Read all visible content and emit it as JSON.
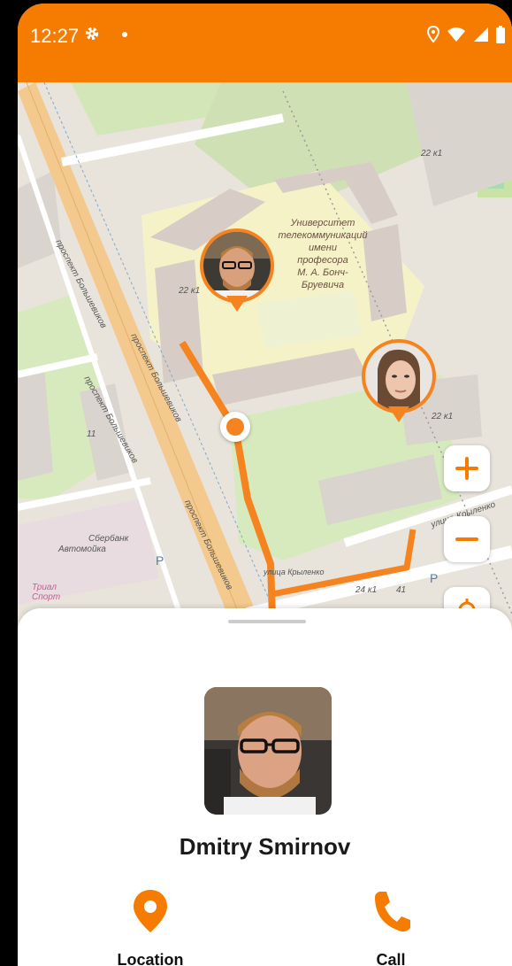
{
  "status_bar": {
    "time": "12:27"
  },
  "map": {
    "university_label_lines": [
      "Университет",
      "телекоммуникаций",
      "имени",
      "професора",
      "М. А. Бонч-",
      "Бруевича"
    ],
    "street_labels": [
      "проспект Большевиков",
      "проспект Большевиков",
      "проспект Большевиков",
      "проспект Большевиков",
      "улица Крыленко",
      "улица Крыленко"
    ],
    "building_numbers": [
      "22 к1",
      "22 к1",
      "22 к1",
      "11",
      "24 к1",
      "41"
    ],
    "poi_labels": [
      "Сбербанк",
      "Автомойка",
      "Триал Спорт"
    ],
    "parking_label": "P"
  },
  "profile": {
    "name": "Dmitry Smirnov"
  },
  "actions": [
    {
      "label": "Location",
      "icon": "location-pin-icon"
    },
    {
      "label": "Call",
      "icon": "phone-icon"
    }
  ],
  "colors": {
    "accent": "#f57c00",
    "route": "#f5831f"
  }
}
